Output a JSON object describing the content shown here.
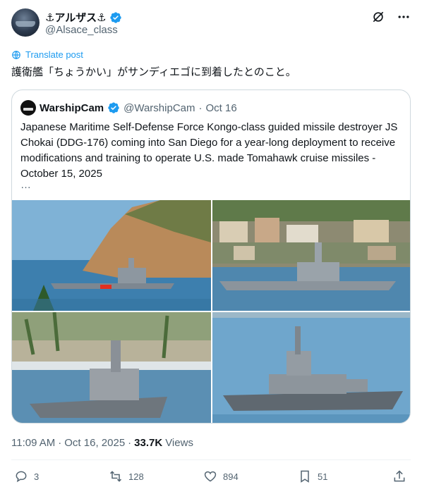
{
  "author": {
    "display_name": "⚓アルザス⚓",
    "handle": "@Alsace_class"
  },
  "header_icons": [
    "grok-icon",
    "more-icon"
  ],
  "translate_label": "Translate post",
  "post_text": "護衛艦「ちょうかい」がサンディエゴに到着したとのこと。",
  "quote": {
    "display_name": "WarshipCam",
    "handle": "@WarshipCam",
    "separator": "·",
    "date": "Oct 16",
    "text": "Japanese Maritime Self-Defense Force Kongo-class guided missile destroyer JS Chokai (DDG-176) coming into San Diego for a year-long deployment to receive modifications and training to operate U.S. made Tomahawk cruise missiles - October 15, 2025",
    "ellipsis": "…",
    "photos": [
      "destroyer-by-headland",
      "destroyer-by-waterfront-town",
      "destroyer-bow-by-marina",
      "destroyer-profile-open-water"
    ]
  },
  "meta": {
    "time": "11:09 AM",
    "separator": "·",
    "date": "Oct 16, 2025",
    "separator2": "·",
    "views_count": "33.7K",
    "views_label": "Views"
  },
  "actions": {
    "replies": "3",
    "reposts": "128",
    "likes": "894",
    "bookmarks": "51"
  },
  "colors": {
    "accent": "#1d9bf0",
    "muted": "#536471",
    "text": "#0f1419",
    "border": "#cfd9de",
    "annotation": "#d62020"
  }
}
